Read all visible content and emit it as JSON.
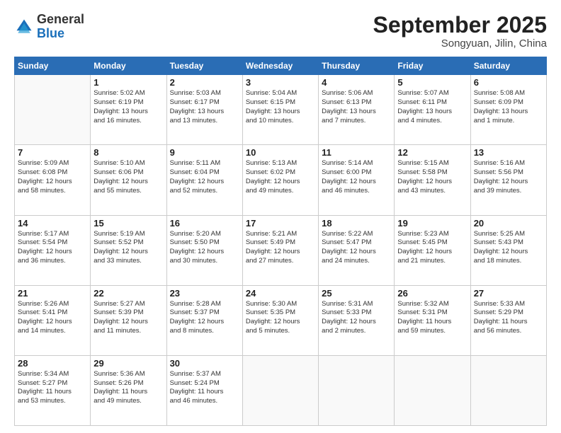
{
  "header": {
    "logo_general": "General",
    "logo_blue": "Blue",
    "month": "September 2025",
    "location": "Songyuan, Jilin, China"
  },
  "days_of_week": [
    "Sunday",
    "Monday",
    "Tuesday",
    "Wednesday",
    "Thursday",
    "Friday",
    "Saturday"
  ],
  "weeks": [
    [
      {
        "day": "",
        "info": ""
      },
      {
        "day": "1",
        "info": "Sunrise: 5:02 AM\nSunset: 6:19 PM\nDaylight: 13 hours\nand 16 minutes."
      },
      {
        "day": "2",
        "info": "Sunrise: 5:03 AM\nSunset: 6:17 PM\nDaylight: 13 hours\nand 13 minutes."
      },
      {
        "day": "3",
        "info": "Sunrise: 5:04 AM\nSunset: 6:15 PM\nDaylight: 13 hours\nand 10 minutes."
      },
      {
        "day": "4",
        "info": "Sunrise: 5:06 AM\nSunset: 6:13 PM\nDaylight: 13 hours\nand 7 minutes."
      },
      {
        "day": "5",
        "info": "Sunrise: 5:07 AM\nSunset: 6:11 PM\nDaylight: 13 hours\nand 4 minutes."
      },
      {
        "day": "6",
        "info": "Sunrise: 5:08 AM\nSunset: 6:09 PM\nDaylight: 13 hours\nand 1 minute."
      }
    ],
    [
      {
        "day": "7",
        "info": "Sunrise: 5:09 AM\nSunset: 6:08 PM\nDaylight: 12 hours\nand 58 minutes."
      },
      {
        "day": "8",
        "info": "Sunrise: 5:10 AM\nSunset: 6:06 PM\nDaylight: 12 hours\nand 55 minutes."
      },
      {
        "day": "9",
        "info": "Sunrise: 5:11 AM\nSunset: 6:04 PM\nDaylight: 12 hours\nand 52 minutes."
      },
      {
        "day": "10",
        "info": "Sunrise: 5:13 AM\nSunset: 6:02 PM\nDaylight: 12 hours\nand 49 minutes."
      },
      {
        "day": "11",
        "info": "Sunrise: 5:14 AM\nSunset: 6:00 PM\nDaylight: 12 hours\nand 46 minutes."
      },
      {
        "day": "12",
        "info": "Sunrise: 5:15 AM\nSunset: 5:58 PM\nDaylight: 12 hours\nand 43 minutes."
      },
      {
        "day": "13",
        "info": "Sunrise: 5:16 AM\nSunset: 5:56 PM\nDaylight: 12 hours\nand 39 minutes."
      }
    ],
    [
      {
        "day": "14",
        "info": "Sunrise: 5:17 AM\nSunset: 5:54 PM\nDaylight: 12 hours\nand 36 minutes."
      },
      {
        "day": "15",
        "info": "Sunrise: 5:19 AM\nSunset: 5:52 PM\nDaylight: 12 hours\nand 33 minutes."
      },
      {
        "day": "16",
        "info": "Sunrise: 5:20 AM\nSunset: 5:50 PM\nDaylight: 12 hours\nand 30 minutes."
      },
      {
        "day": "17",
        "info": "Sunrise: 5:21 AM\nSunset: 5:49 PM\nDaylight: 12 hours\nand 27 minutes."
      },
      {
        "day": "18",
        "info": "Sunrise: 5:22 AM\nSunset: 5:47 PM\nDaylight: 12 hours\nand 24 minutes."
      },
      {
        "day": "19",
        "info": "Sunrise: 5:23 AM\nSunset: 5:45 PM\nDaylight: 12 hours\nand 21 minutes."
      },
      {
        "day": "20",
        "info": "Sunrise: 5:25 AM\nSunset: 5:43 PM\nDaylight: 12 hours\nand 18 minutes."
      }
    ],
    [
      {
        "day": "21",
        "info": "Sunrise: 5:26 AM\nSunset: 5:41 PM\nDaylight: 12 hours\nand 14 minutes."
      },
      {
        "day": "22",
        "info": "Sunrise: 5:27 AM\nSunset: 5:39 PM\nDaylight: 12 hours\nand 11 minutes."
      },
      {
        "day": "23",
        "info": "Sunrise: 5:28 AM\nSunset: 5:37 PM\nDaylight: 12 hours\nand 8 minutes."
      },
      {
        "day": "24",
        "info": "Sunrise: 5:30 AM\nSunset: 5:35 PM\nDaylight: 12 hours\nand 5 minutes."
      },
      {
        "day": "25",
        "info": "Sunrise: 5:31 AM\nSunset: 5:33 PM\nDaylight: 12 hours\nand 2 minutes."
      },
      {
        "day": "26",
        "info": "Sunrise: 5:32 AM\nSunset: 5:31 PM\nDaylight: 11 hours\nand 59 minutes."
      },
      {
        "day": "27",
        "info": "Sunrise: 5:33 AM\nSunset: 5:29 PM\nDaylight: 11 hours\nand 56 minutes."
      }
    ],
    [
      {
        "day": "28",
        "info": "Sunrise: 5:34 AM\nSunset: 5:27 PM\nDaylight: 11 hours\nand 53 minutes."
      },
      {
        "day": "29",
        "info": "Sunrise: 5:36 AM\nSunset: 5:26 PM\nDaylight: 11 hours\nand 49 minutes."
      },
      {
        "day": "30",
        "info": "Sunrise: 5:37 AM\nSunset: 5:24 PM\nDaylight: 11 hours\nand 46 minutes."
      },
      {
        "day": "",
        "info": ""
      },
      {
        "day": "",
        "info": ""
      },
      {
        "day": "",
        "info": ""
      },
      {
        "day": "",
        "info": ""
      }
    ]
  ]
}
